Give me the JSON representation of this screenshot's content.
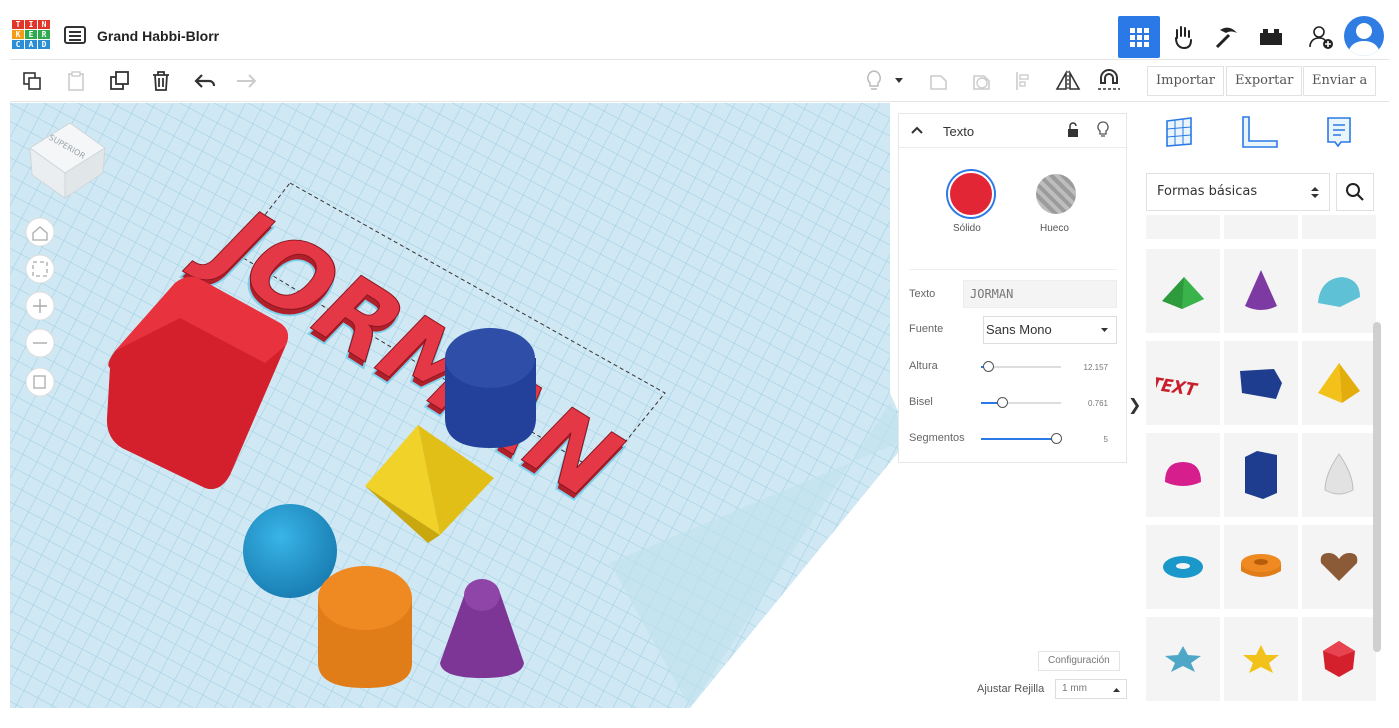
{
  "app": {
    "logo_letters": [
      "T",
      "I",
      "N",
      "K",
      "E",
      "R",
      "C",
      "A",
      "D"
    ],
    "design_title": "Grand Habbi-Blorr"
  },
  "header": {
    "icons": [
      "grid-view-icon",
      "hand-icon",
      "pickaxe-icon",
      "brick-icon",
      "add-user-icon",
      "avatar-icon"
    ],
    "accent": "#2b79e6"
  },
  "toolbar": {
    "left_icons": [
      "copy-icon",
      "paste-icon",
      "duplicate-icon",
      "delete-icon",
      "undo-icon",
      "redo-icon"
    ],
    "right_icons": [
      "light-icon",
      "caret-down-icon",
      "group-icon",
      "ungroup-icon",
      "align-icon",
      "mirror-icon",
      "magnet-icon"
    ],
    "import_label": "Importar",
    "export_label": "Exportar",
    "send_label": "Enviar a"
  },
  "viewcube": {
    "face_label": "SUPERIOR"
  },
  "inspector": {
    "title": "Texto",
    "solid_label": "Sólido",
    "hole_label": "Hueco",
    "text_label": "Texto",
    "text_value": "JORMAN",
    "font_label": "Fuente",
    "font_value": "Sans Mono",
    "height_label": "Altura",
    "height_value": "12.157",
    "bevel_label": "Bisel",
    "bevel_value": "0.761",
    "segments_label": "Segmentos",
    "segments_value": "5",
    "solid_color": "#e32636"
  },
  "scene": {
    "text_object": "JORMAN"
  },
  "palette": {
    "category": "Formas básicas",
    "shapes": [
      "wedge",
      "cone",
      "half-cylinder",
      "text",
      "polygon",
      "pyramid",
      "half-sphere",
      "hexagonal-prism",
      "paraboloid",
      "torus",
      "tube",
      "heart",
      "star",
      "star-yellow",
      "icosahedron"
    ]
  },
  "footer": {
    "settings_label": "Configuración",
    "snap_label": "Ajustar Rejilla",
    "snap_value": "1 mm"
  }
}
